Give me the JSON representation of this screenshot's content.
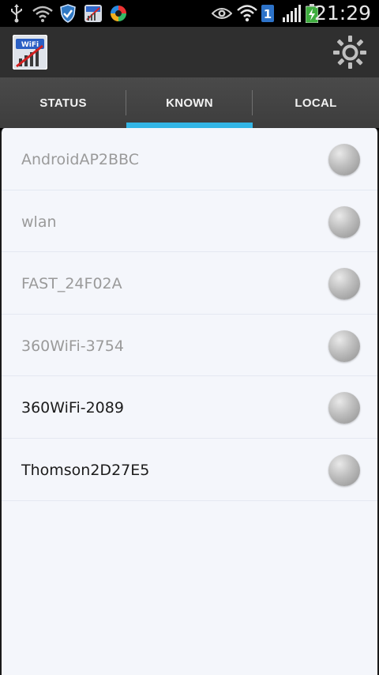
{
  "status_bar": {
    "time": "21:29",
    "icons": [
      "usb-icon",
      "wifi-open-icon",
      "shield-icon",
      "wifi-app-icon",
      "sync-app-icon",
      "eye-icon",
      "wifi-signal-icon",
      "sim-1-icon",
      "cell-signal-icon",
      "battery-charging-icon"
    ]
  },
  "action_bar": {
    "logo_text": "WiFi",
    "settings_icon": "gear-icon"
  },
  "tabs": [
    {
      "label": "STATUS",
      "active": false
    },
    {
      "label": "KNOWN",
      "active": true
    },
    {
      "label": "LOCAL",
      "active": false
    }
  ],
  "networks": [
    {
      "ssid": "AndroidAP2BBC",
      "dim": true
    },
    {
      "ssid": "wlan",
      "dim": true
    },
    {
      "ssid": "FAST_24F02A",
      "dim": true
    },
    {
      "ssid": "360WiFi-3754",
      "dim": true
    },
    {
      "ssid": "360WiFi-2089",
      "dim": false
    },
    {
      "ssid": "Thomson2D27E5",
      "dim": false
    }
  ],
  "colors": {
    "accent": "#33b5e5",
    "action_bar": "#2f2f2f",
    "content_bg": "#f4f6fb"
  }
}
